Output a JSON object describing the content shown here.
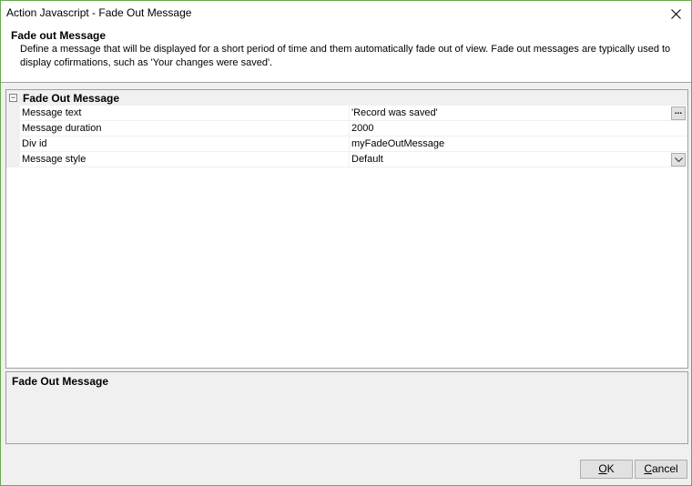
{
  "window": {
    "title": "Action Javascript - Fade Out Message"
  },
  "header": {
    "title": "Fade out Message",
    "description": "Define a message that will be displayed for a short period of time and them automatically fade out of view. Fade out messages are typically used to display cofirmations, such as 'Your changes were saved'."
  },
  "grid": {
    "category": "Fade Out Message",
    "properties": [
      {
        "name": "Message text",
        "value": "'Record was saved'"
      },
      {
        "name": "Message duration",
        "value": "2000"
      },
      {
        "name": "Div id",
        "value": "myFadeOutMessage"
      },
      {
        "name": "Message style",
        "value": "Default"
      }
    ],
    "ellipsis_label": "..."
  },
  "description_panel": {
    "title": "Fade Out Message"
  },
  "buttons": {
    "ok_mnemonic": "O",
    "ok_rest": "K",
    "cancel_mnemonic": "C",
    "cancel_rest": "ancel"
  }
}
